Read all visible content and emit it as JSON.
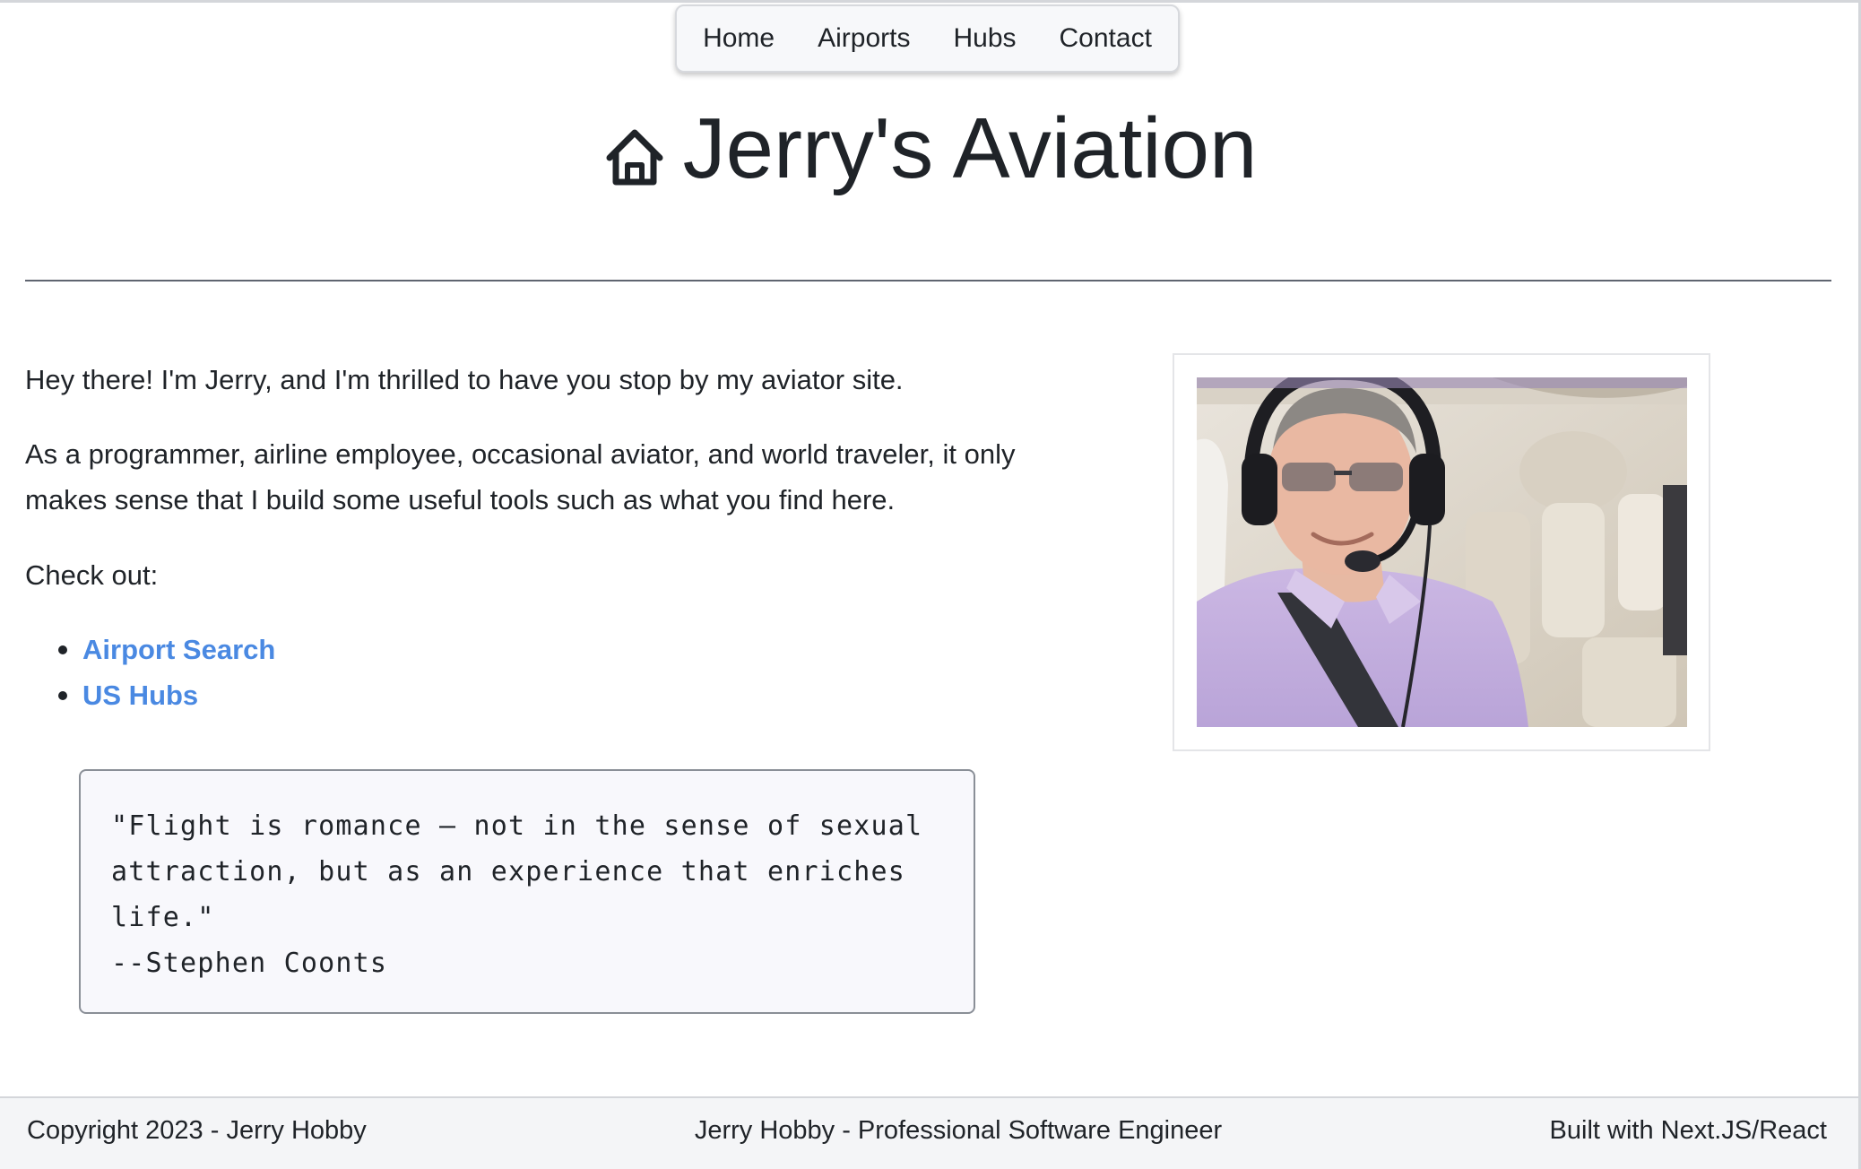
{
  "nav": {
    "items": [
      {
        "label": "Home"
      },
      {
        "label": "Airports"
      },
      {
        "label": "Hubs"
      },
      {
        "label": "Contact"
      }
    ]
  },
  "header": {
    "title": "Jerry's Aviation",
    "icon": "home-icon"
  },
  "main": {
    "intro": "Hey there! I'm Jerry, and I'm thrilled to have you stop by my aviator site.",
    "about": "As a programmer, airline employee, occasional aviator, and world traveler, it only makes sense that I build some useful tools such as what you find here.",
    "check_out": "Check out:",
    "links": [
      {
        "label": "Airport Search"
      },
      {
        "label": "US Hubs"
      }
    ]
  },
  "quote": {
    "text": "\"Flight is romance — not in the sense of sexual attraction, but as an experience that enriches life.\"",
    "author": "--Stephen Coonts"
  },
  "photo": {
    "subject": "man-with-headset-in-aircraft-cabin"
  },
  "footer": {
    "left": "Copyright 2023 - Jerry Hobby",
    "center": "Jerry Hobby - Professional Software Engineer",
    "right": "Built with Next.JS/React"
  },
  "colors": {
    "link": "#4a89e2",
    "text": "#1f2328",
    "footer_bg": "#f4f5f7",
    "quote_bg": "#f8f8fc"
  }
}
